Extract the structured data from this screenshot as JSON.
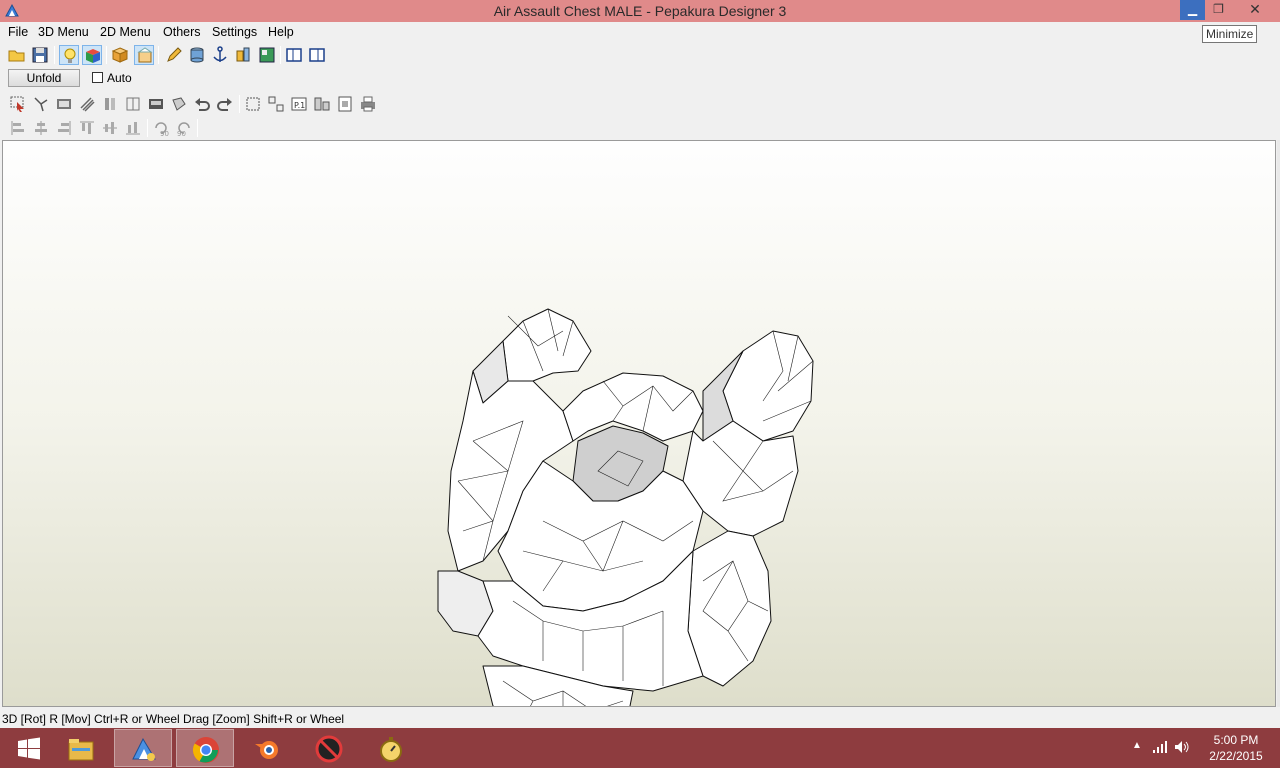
{
  "window": {
    "title": "Air Assault Chest MALE - Pepakura Designer 3",
    "tooltip": "Minimize"
  },
  "menu": [
    "File",
    "3D Menu",
    "2D Menu",
    "Others",
    "Settings",
    "Help"
  ],
  "toolbar": {
    "unfold_label": "Unfold",
    "auto_label": "Auto",
    "auto_checked": false,
    "rotate_90_left": "90",
    "rotate_90_right": "90"
  },
  "status": {
    "text": "3D [Rot] R [Mov] Ctrl+R or Wheel Drag [Zoom] Shift+R or Wheel"
  },
  "taskbar": {
    "apps": [
      "start-icon",
      "file-explorer-icon",
      "pepakura-icon",
      "chrome-icon",
      "blender-icon",
      "no-entry-icon",
      "stopwatch-icon"
    ],
    "clock_time": "5:00 PM",
    "clock_date": "2/22/2015"
  },
  "colors": {
    "titlebar": "#e08a8a",
    "taskbar": "#8e3c3f",
    "minimize_hover": "#3c6fbf"
  }
}
